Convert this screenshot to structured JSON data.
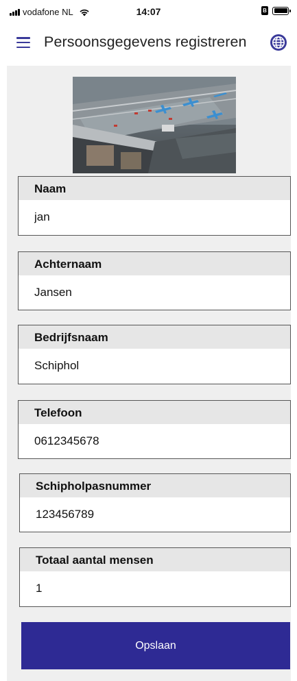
{
  "status_bar": {
    "carrier": "vodafone NL",
    "time": "14:07",
    "lock_badge": "B"
  },
  "app_bar": {
    "title": "Persoonsgegevens registreren",
    "menu_icon": "hamburger-menu-icon",
    "language_icon": "globe-icon"
  },
  "hero_image": {
    "subject": "aerial-airport-construction-photo"
  },
  "form": {
    "fields": [
      {
        "label": "Naam",
        "value": "jan"
      },
      {
        "label": "Achternaam",
        "value": "Jansen"
      },
      {
        "label": "Bedrijfsnaam",
        "value": "Schiphol"
      },
      {
        "label": "Telefoon",
        "value": "0612345678"
      },
      {
        "label": "Schipholpasnummer",
        "value": "123456789"
      },
      {
        "label": "Totaal aantal mensen",
        "value": "1"
      }
    ],
    "save_label": "Opslaan"
  },
  "colors": {
    "accent": "#2e2a94",
    "menu_icon": "#3a3a9a",
    "background": "#efefef",
    "label_background": "#e6e6e6"
  }
}
